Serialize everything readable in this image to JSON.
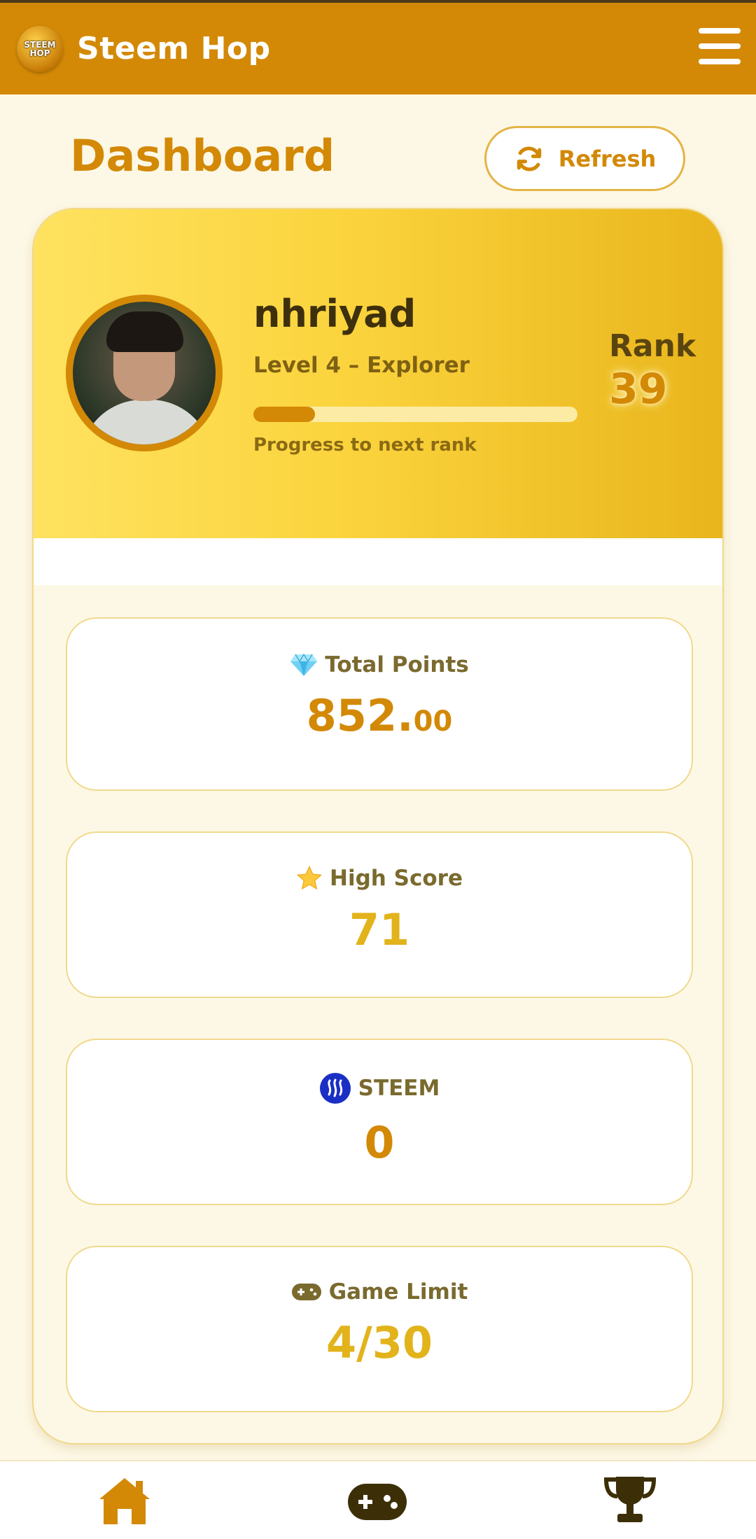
{
  "app": {
    "title": "Steem Hop",
    "logo_text": "STEEM HOP"
  },
  "page": {
    "title": "Dashboard",
    "refresh_label": "Refresh"
  },
  "profile": {
    "username": "nhriyad",
    "level": "Level 4 – Explorer",
    "progress": 0.19,
    "progress_label": "Progress to next rank",
    "rank_label": "Rank",
    "rank_value": "39"
  },
  "stats": {
    "total_points": {
      "label": "Total Points",
      "value_int": "852.",
      "value_dec": "00",
      "icon": "gem-icon"
    },
    "high_score": {
      "label": "High Score",
      "value": "71",
      "icon": "star-icon"
    },
    "steem": {
      "label": "STEEM",
      "value": "0",
      "icon": "steem-icon"
    },
    "game_limit": {
      "label": "Game Limit",
      "value": "4/30",
      "icon": "gamepad-icon"
    }
  },
  "nav": {
    "items": [
      "home-icon",
      "gamepad-icon",
      "trophy-icon"
    ]
  },
  "colors": {
    "primary": "#d38906",
    "accent": "#e2b31a",
    "background": "#fdf8e6"
  }
}
